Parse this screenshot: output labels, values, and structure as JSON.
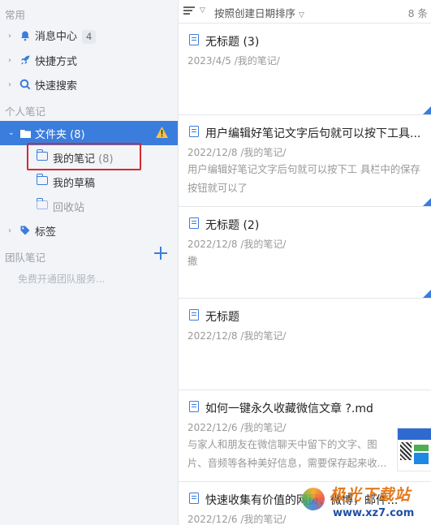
{
  "sidebar": {
    "section_common": "常用",
    "common_items": [
      {
        "label": "消息中心",
        "badge": "4",
        "icon": "bell-icon"
      },
      {
        "label": "快捷方式",
        "icon": "rocket-icon"
      },
      {
        "label": "快速搜索",
        "icon": "search-icon"
      }
    ],
    "section_personal": "个人笔记",
    "folder": {
      "label": "文件夹",
      "count": "(8)",
      "icon": "folder-icon",
      "warning_icon": "warning-icon"
    },
    "subfolders": [
      {
        "label": "我的笔记",
        "count": "(8)"
      },
      {
        "label": "我的草稿",
        "count": ""
      },
      {
        "label": "回收站",
        "count": ""
      }
    ],
    "tags_label": "标签",
    "section_team": "团队笔记",
    "team_hint": "免费开通团队服务...",
    "accent_color": "#3b7ddd",
    "highlight_color": "#d9282f"
  },
  "toolbar": {
    "sort_label": "按照创建日期排序",
    "count_label": "8 条"
  },
  "notes": [
    {
      "title": "无标题 (3)",
      "meta": "2023/4/5  /我的笔记/",
      "snippet": ""
    },
    {
      "title": "用户编辑好笔记文字后句就可以按下工具...",
      "meta": "2022/12/8  /我的笔记/",
      "snippet": "用户编辑好笔记文字后句就可以按下工 具栏中的保存按钮就可以了"
    },
    {
      "title": "无标题 (2)",
      "meta": "2022/12/8  /我的笔记/",
      "snippet": "撒"
    },
    {
      "title": "无标题",
      "meta": "2022/12/8  /我的笔记/",
      "snippet": ""
    },
    {
      "title": "如何一键永久收藏微信文章 ?.md",
      "meta": "2022/12/6  /我的笔记/",
      "snippet": " 与家人和朋友在微信聊天中留下的文字、图片、音频等各种美好信息，需要保存起来收..."
    },
    {
      "title": "快速收集有价值的网页、微博，邮件...",
      "meta": "2022/12/6  /我的笔记/",
      "snippet": ""
    }
  ],
  "watermark": {
    "text": "极光下载站",
    "url": "www.xz7.com"
  }
}
